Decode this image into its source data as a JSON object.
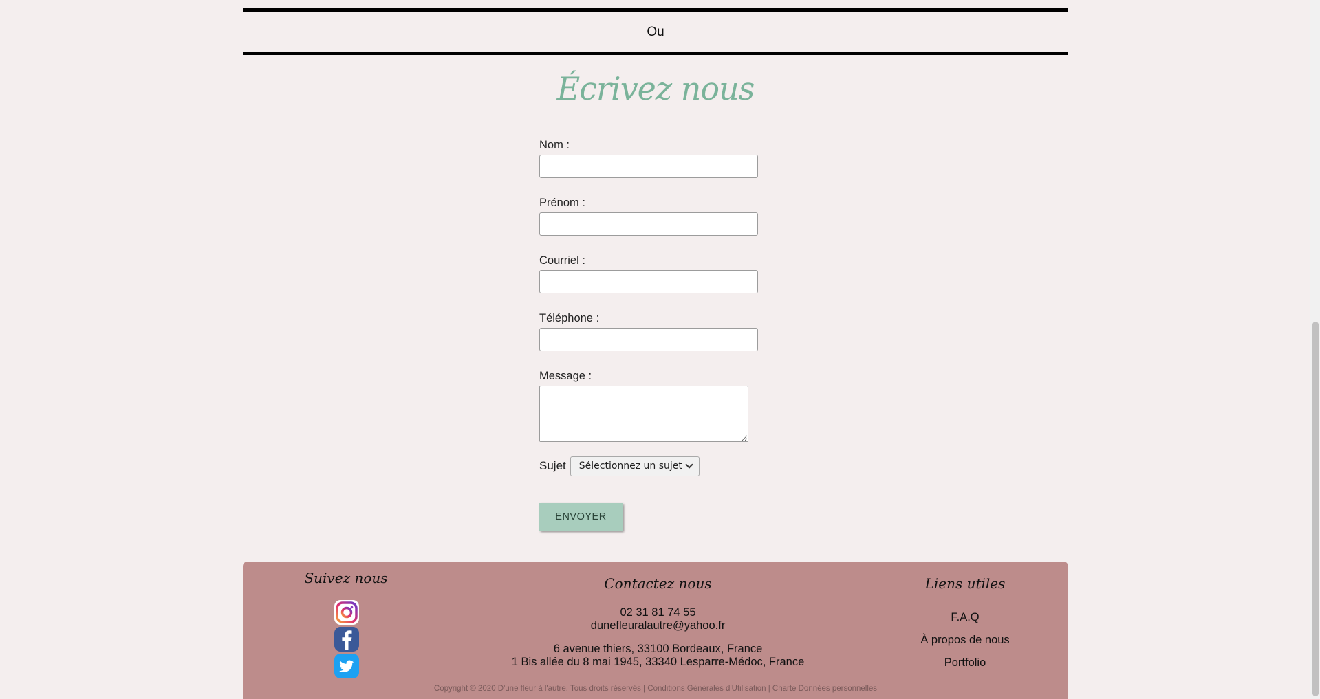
{
  "separator": {
    "text": "Ou"
  },
  "form": {
    "title": "Écrivez nous",
    "fields": {
      "nom": {
        "label": "Nom :",
        "value": ""
      },
      "prenom": {
        "label": "Prénom :",
        "value": ""
      },
      "courriel": {
        "label": "Courriel :",
        "value": ""
      },
      "telephone": {
        "label": "Téléphone :",
        "value": ""
      },
      "message": {
        "label": "Message :",
        "value": ""
      }
    },
    "subject": {
      "label": "Sujet",
      "selected": "Sélectionnez un sujet"
    },
    "submit_label": "ENVOYER"
  },
  "footer": {
    "follow": {
      "heading": "Suivez nous",
      "icons": [
        "instagram-icon",
        "facebook-icon",
        "twitter-icon"
      ]
    },
    "contact": {
      "heading": "Contactez nous",
      "phone": "02 31 81 74 55",
      "email": "dunefleuralautre@yahoo.fr",
      "address_1": "6 avenue thiers, 33100 Bordeaux, France",
      "address_2": "1 Bis allée du 8 mai 1945, 33340 Lesparre-Médoc, France"
    },
    "links": {
      "heading": "Liens utiles",
      "items": [
        "F.A.Q",
        "À propos de nous",
        "Portfolio"
      ]
    },
    "copyright": {
      "text": "Copyright © 2020 D'une fleur à l'autre. Tous droits réservés |",
      "cgu": "Conditions Générales d'Utilisation",
      "sep": "|",
      "charte": "Charte Données personnelles"
    }
  },
  "colors": {
    "background": "#f4eeee",
    "title": "#7ab39a",
    "button": "#a8cdbd",
    "footer": "#bd8c8b"
  }
}
